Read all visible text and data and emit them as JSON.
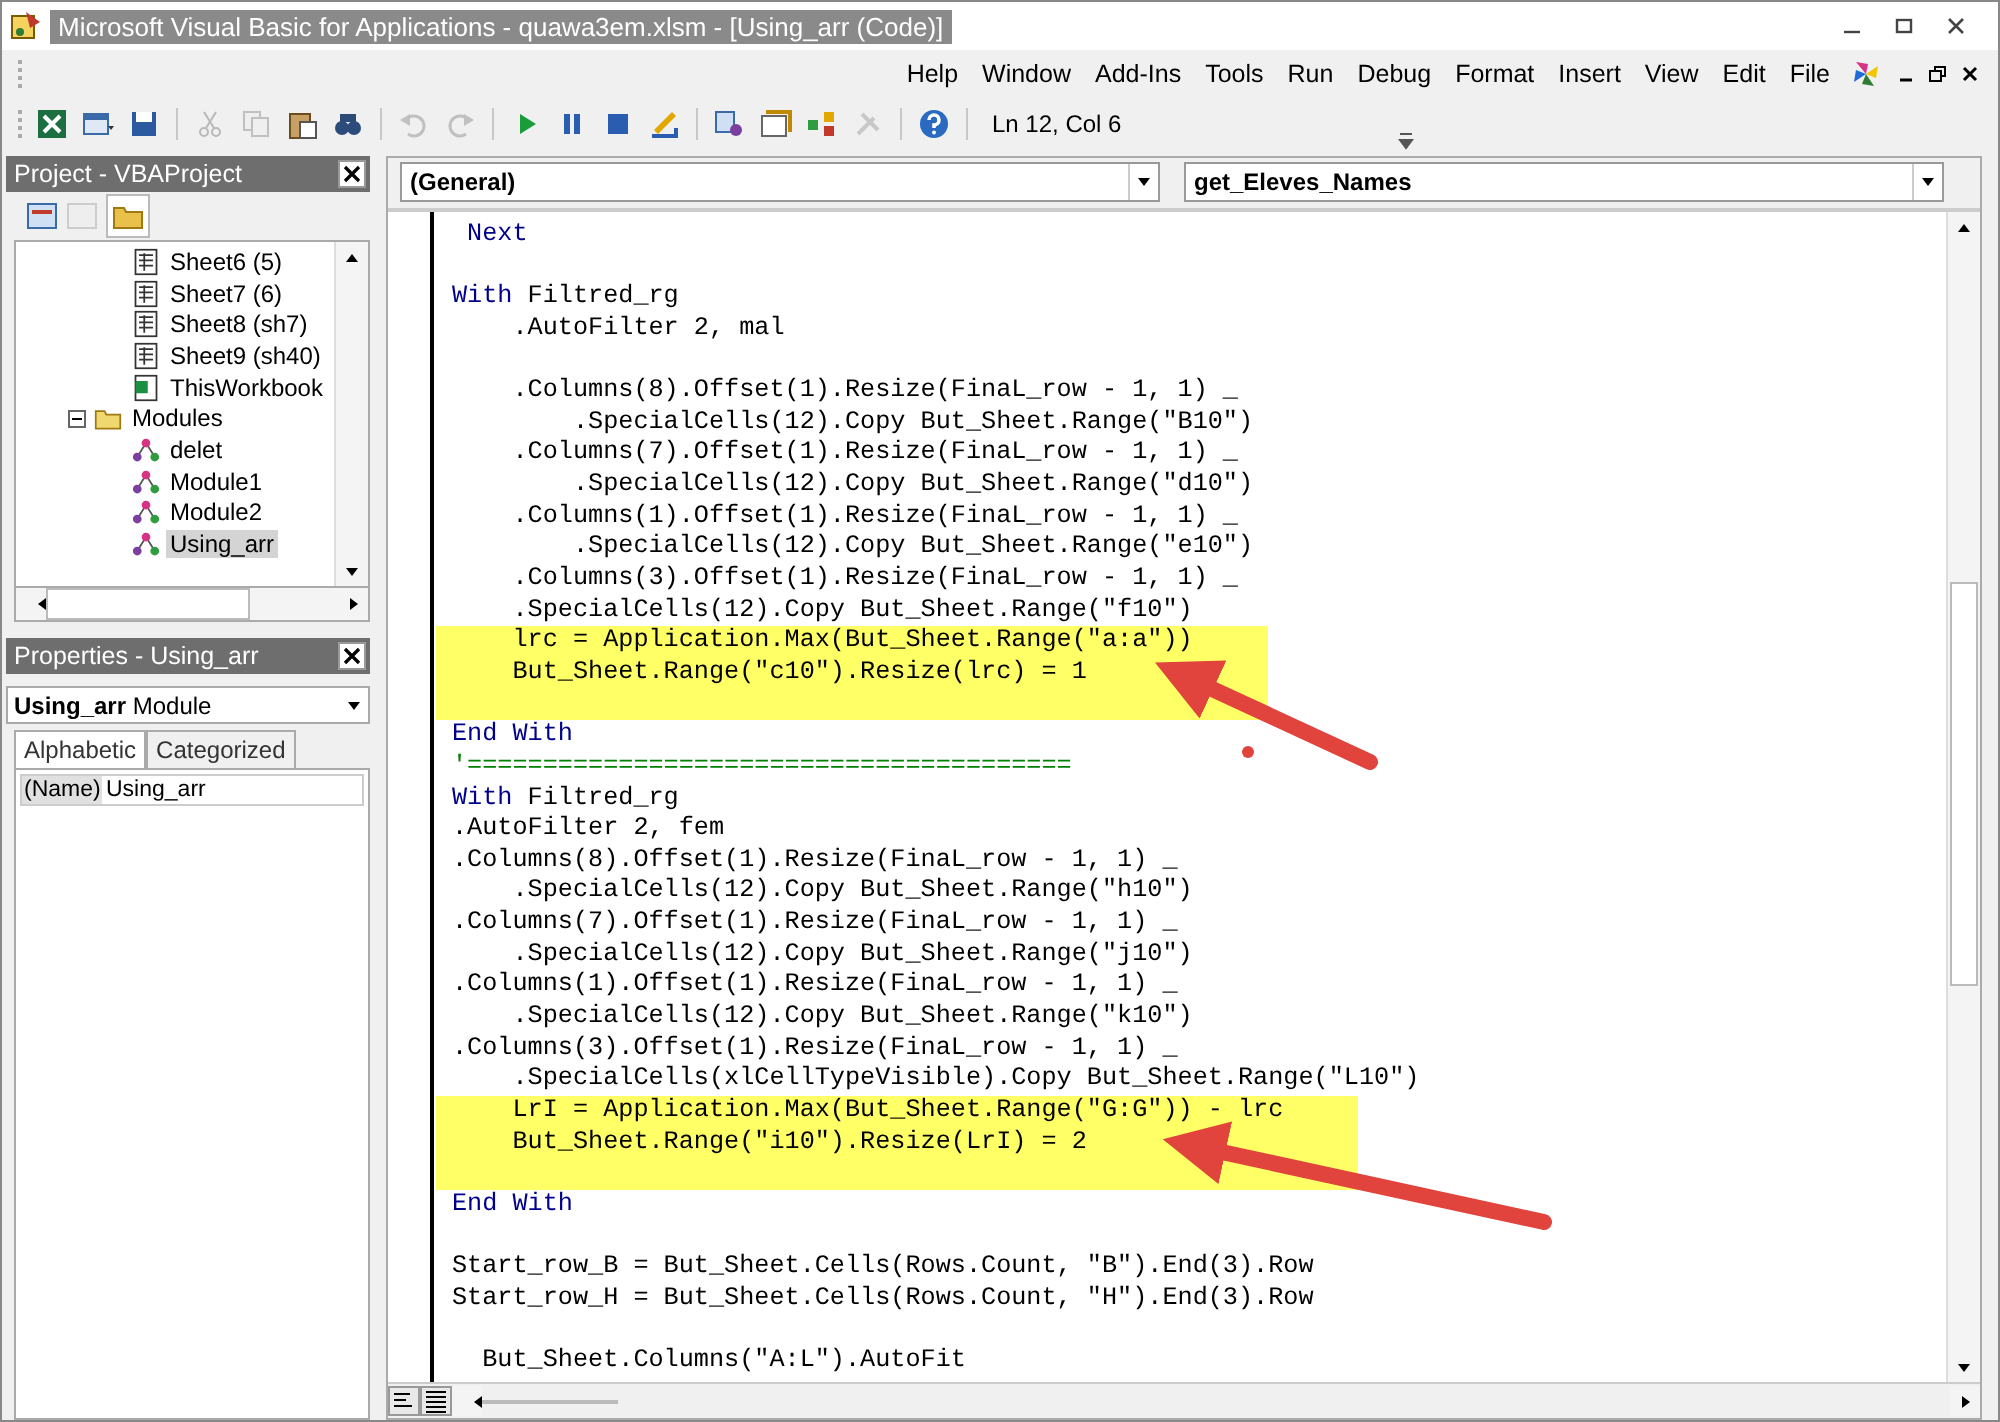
{
  "window": {
    "title": "Microsoft Visual Basic for Applications - quawa3em.xlsm - [Using_arr (Code)]"
  },
  "menu": [
    "Help",
    "Window",
    "Add-Ins",
    "Tools",
    "Run",
    "Debug",
    "Format",
    "Insert",
    "View",
    "Edit",
    "File"
  ],
  "toolbar": {
    "buttons": [
      {
        "kind": "excel",
        "disabled": false
      },
      {
        "kind": "insert-form",
        "disabled": false
      },
      {
        "kind": "save",
        "disabled": false
      },
      {
        "kind": "cut",
        "disabled": true
      },
      {
        "kind": "copy",
        "disabled": true
      },
      {
        "kind": "paste",
        "disabled": false
      },
      {
        "kind": "find",
        "disabled": false
      },
      {
        "kind": "undo",
        "disabled": true
      },
      {
        "kind": "redo",
        "disabled": true
      },
      {
        "kind": "run",
        "disabled": false
      },
      {
        "kind": "pause",
        "disabled": false
      },
      {
        "kind": "stop",
        "disabled": false
      },
      {
        "kind": "design",
        "disabled": false
      },
      {
        "kind": "explorer",
        "disabled": false
      },
      {
        "kind": "properties",
        "disabled": false
      },
      {
        "kind": "browser",
        "disabled": false
      },
      {
        "kind": "toolbox",
        "disabled": true
      },
      {
        "kind": "help",
        "disabled": false
      }
    ],
    "position": "Ln 12, Col 6"
  },
  "project": {
    "title": "Project - VBAProject",
    "tree": [
      {
        "kind": "scrolled-group",
        "children": [
          {
            "kind": "sheet",
            "label": "Sheet6 (5)",
            "selected": false
          },
          {
            "kind": "sheet",
            "label": "Sheet7 (6)",
            "selected": false
          },
          {
            "kind": "sheet",
            "label": "Sheet8 (sh7)",
            "selected": false
          },
          {
            "kind": "sheet",
            "label": "Sheet9 (sh40)",
            "selected": false
          },
          {
            "kind": "workbook",
            "label": "ThisWorkbook",
            "selected": false
          }
        ]
      },
      {
        "kind": "folder",
        "label": "Modules",
        "expanded": true,
        "selected": false,
        "children": [
          {
            "kind": "module",
            "label": "delet",
            "selected": false
          },
          {
            "kind": "module",
            "label": "Module1",
            "selected": false
          },
          {
            "kind": "module",
            "label": "Module2",
            "selected": false
          },
          {
            "kind": "module",
            "label": "Using_arr",
            "selected": true
          }
        ]
      }
    ]
  },
  "properties": {
    "title": "Properties - Using_arr",
    "object": "**Using_arr** Module",
    "tabs": [
      {
        "label": "Alphabetic",
        "selected": true
      },
      {
        "label": "Categorized",
        "selected": false
      }
    ],
    "rows": [
      {
        "name": "(Name)",
        "value": "Using_arr"
      }
    ]
  },
  "code": {
    "object": "(General)",
    "procedure": "get_Eleves_Names",
    "lines": [
      {
        "highlighted": false,
        "parts": [
          {
            "kind": "keyword",
            "text": " Next"
          }
        ]
      },
      {
        "highlighted": false
      },
      {
        "highlighted": false,
        "parts": [
          {
            "kind": "keyword",
            "text": "With"
          },
          {
            "kind": "code",
            "text": " Filtred_rg"
          }
        ]
      },
      {
        "highlighted": false,
        "parts": [
          {
            "kind": "code",
            "text": "    .AutoFilter 2, mal"
          }
        ]
      },
      {
        "highlighted": false
      },
      {
        "highlighted": false,
        "parts": [
          {
            "kind": "code",
            "text": "    .Columns(8).Offset(1).Resize(FinaL_row - 1, 1) _"
          }
        ]
      },
      {
        "highlighted": false,
        "parts": [
          {
            "kind": "code",
            "text": "        .SpecialCells(12).Copy But_Sheet.Range(\"B10\")"
          }
        ]
      },
      {
        "highlighted": false,
        "parts": [
          {
            "kind": "code",
            "text": "    .Columns(7).Offset(1).Resize(FinaL_row - 1, 1) _"
          }
        ]
      },
      {
        "highlighted": false,
        "parts": [
          {
            "kind": "code",
            "text": "        .SpecialCells(12).Copy But_Sheet.Range(\"d10\")"
          }
        ]
      },
      {
        "highlighted": false,
        "parts": [
          {
            "kind": "code",
            "text": "    .Columns(1).Offset(1).Resize(FinaL_row - 1, 1) _"
          }
        ]
      },
      {
        "highlighted": false,
        "parts": [
          {
            "kind": "code",
            "text": "        .SpecialCells(12).Copy But_Sheet.Range(\"e10\")"
          }
        ]
      },
      {
        "highlighted": false,
        "parts": [
          {
            "kind": "code",
            "text": "    .Columns(3).Offset(1).Resize(FinaL_row - 1, 1) _"
          }
        ]
      },
      {
        "highlighted": false,
        "parts": [
          {
            "kind": "code",
            "text": "    .SpecialCells(12).Copy But_Sheet.Range(\"f10\")"
          }
        ]
      },
      {
        "highlighted": true,
        "parts": [
          {
            "kind": "code",
            "text": "    lrc = Application.Max(But_Sheet.Range(\"a:a\"))"
          }
        ]
      },
      {
        "highlighted": true,
        "parts": [
          {
            "kind": "code",
            "text": "    But_Sheet.Range(\"c10\").Resize(lrc) = 1"
          }
        ]
      },
      {
        "highlighted": true
      },
      {
        "highlighted": false,
        "parts": [
          {
            "kind": "keyword",
            "text": "End With"
          }
        ]
      },
      {
        "highlighted": false,
        "parts": [
          {
            "kind": "comment",
            "text": "'========================================"
          }
        ]
      },
      {
        "highlighted": false,
        "parts": [
          {
            "kind": "keyword",
            "text": "With"
          },
          {
            "kind": "code",
            "text": " Filtred_rg"
          }
        ]
      },
      {
        "highlighted": false,
        "parts": [
          {
            "kind": "code",
            "text": ".AutoFilter 2, fem"
          }
        ]
      },
      {
        "highlighted": false,
        "parts": [
          {
            "kind": "code",
            "text": ".Columns(8).Offset(1).Resize(FinaL_row - 1, 1) _"
          }
        ]
      },
      {
        "highlighted": false,
        "parts": [
          {
            "kind": "code",
            "text": "    .SpecialCells(12).Copy But_Sheet.Range(\"h10\")"
          }
        ]
      },
      {
        "highlighted": false,
        "parts": [
          {
            "kind": "code",
            "text": ".Columns(7).Offset(1).Resize(FinaL_row - 1, 1) _"
          }
        ]
      },
      {
        "highlighted": false,
        "parts": [
          {
            "kind": "code",
            "text": "    .SpecialCells(12).Copy But_Sheet.Range(\"j10\")"
          }
        ]
      },
      {
        "highlighted": false,
        "parts": [
          {
            "kind": "code",
            "text": ".Columns(1).Offset(1).Resize(FinaL_row - 1, 1) _"
          }
        ]
      },
      {
        "highlighted": false,
        "parts": [
          {
            "kind": "code",
            "text": "    .SpecialCells(12).Copy But_Sheet.Range(\"k10\")"
          }
        ]
      },
      {
        "highlighted": false,
        "parts": [
          {
            "kind": "code",
            "text": ".Columns(3).Offset(1).Resize(FinaL_row - 1, 1) _"
          }
        ]
      },
      {
        "highlighted": false,
        "parts": [
          {
            "kind": "code",
            "text": "    .SpecialCells(xlCellTypeVisible).Copy But_Sheet.Range(\"L10\")"
          }
        ]
      },
      {
        "highlighted": true,
        "parts": [
          {
            "kind": "code",
            "text": "    LrI = Application.Max(But_Sheet.Range(\"G:G\")) - lrc"
          }
        ]
      },
      {
        "highlighted": true,
        "parts": [
          {
            "kind": "code",
            "text": "    But_Sheet.Range(\"i10\").Resize(LrI) = 2"
          }
        ]
      },
      {
        "highlighted": true
      },
      {
        "highlighted": false,
        "parts": [
          {
            "kind": "keyword",
            "text": "End With"
          }
        ]
      },
      {
        "highlighted": false
      },
      {
        "highlighted": false,
        "parts": [
          {
            "kind": "code",
            "text": "Start_row_B = But_Sheet.Cells(Rows.Count, \"B\").End(3).Row"
          }
        ]
      },
      {
        "highlighted": false,
        "parts": [
          {
            "kind": "code",
            "text": "Start_row_H = But_Sheet.Cells(Rows.Count, \"H\").End(3).Row"
          }
        ]
      },
      {
        "highlighted": false
      },
      {
        "highlighted": false,
        "parts": [
          {
            "kind": "code",
            "text": "  But_Sheet.Columns(\"A:L\").AutoFit"
          }
        ]
      }
    ]
  }
}
